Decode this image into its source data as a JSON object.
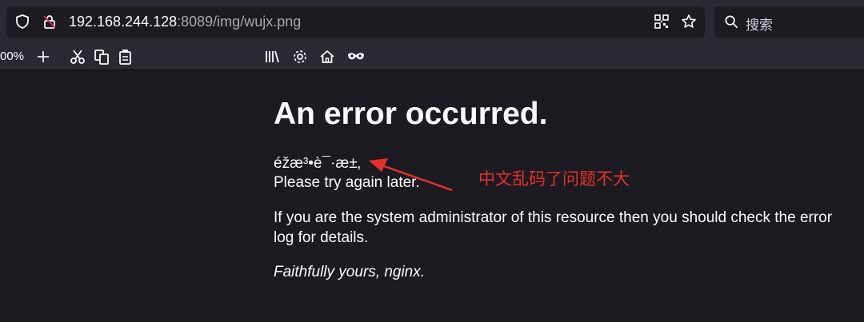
{
  "browser": {
    "url_host": "192.168.244.128",
    "url_rest": ":8089/img/wujx.png",
    "search_placeholder": "搜索",
    "icons": [
      "shield-icon",
      "insecure-lock-icon",
      "qr-code-icon",
      "bookmark-star-icon",
      "search-icon"
    ]
  },
  "toolbar": {
    "zoom": "00%",
    "icons": [
      "zoom-in-icon",
      "cut-icon",
      "copy-icon",
      "paste-icon",
      "library-icon",
      "settings-icon",
      "home-icon",
      "private-mask-icon"
    ]
  },
  "page": {
    "title": "An error occurred.",
    "garbled_line": "éžæ³•è¯·æ±‚",
    "line2": "Please try again later.",
    "line3": "If you are the system administrator of this resource then you should check the error log for details.",
    "signature": "Faithfully yours, nginx."
  },
  "annotation": {
    "text": "中文乱码了问题不大",
    "color": "#e8302a"
  }
}
